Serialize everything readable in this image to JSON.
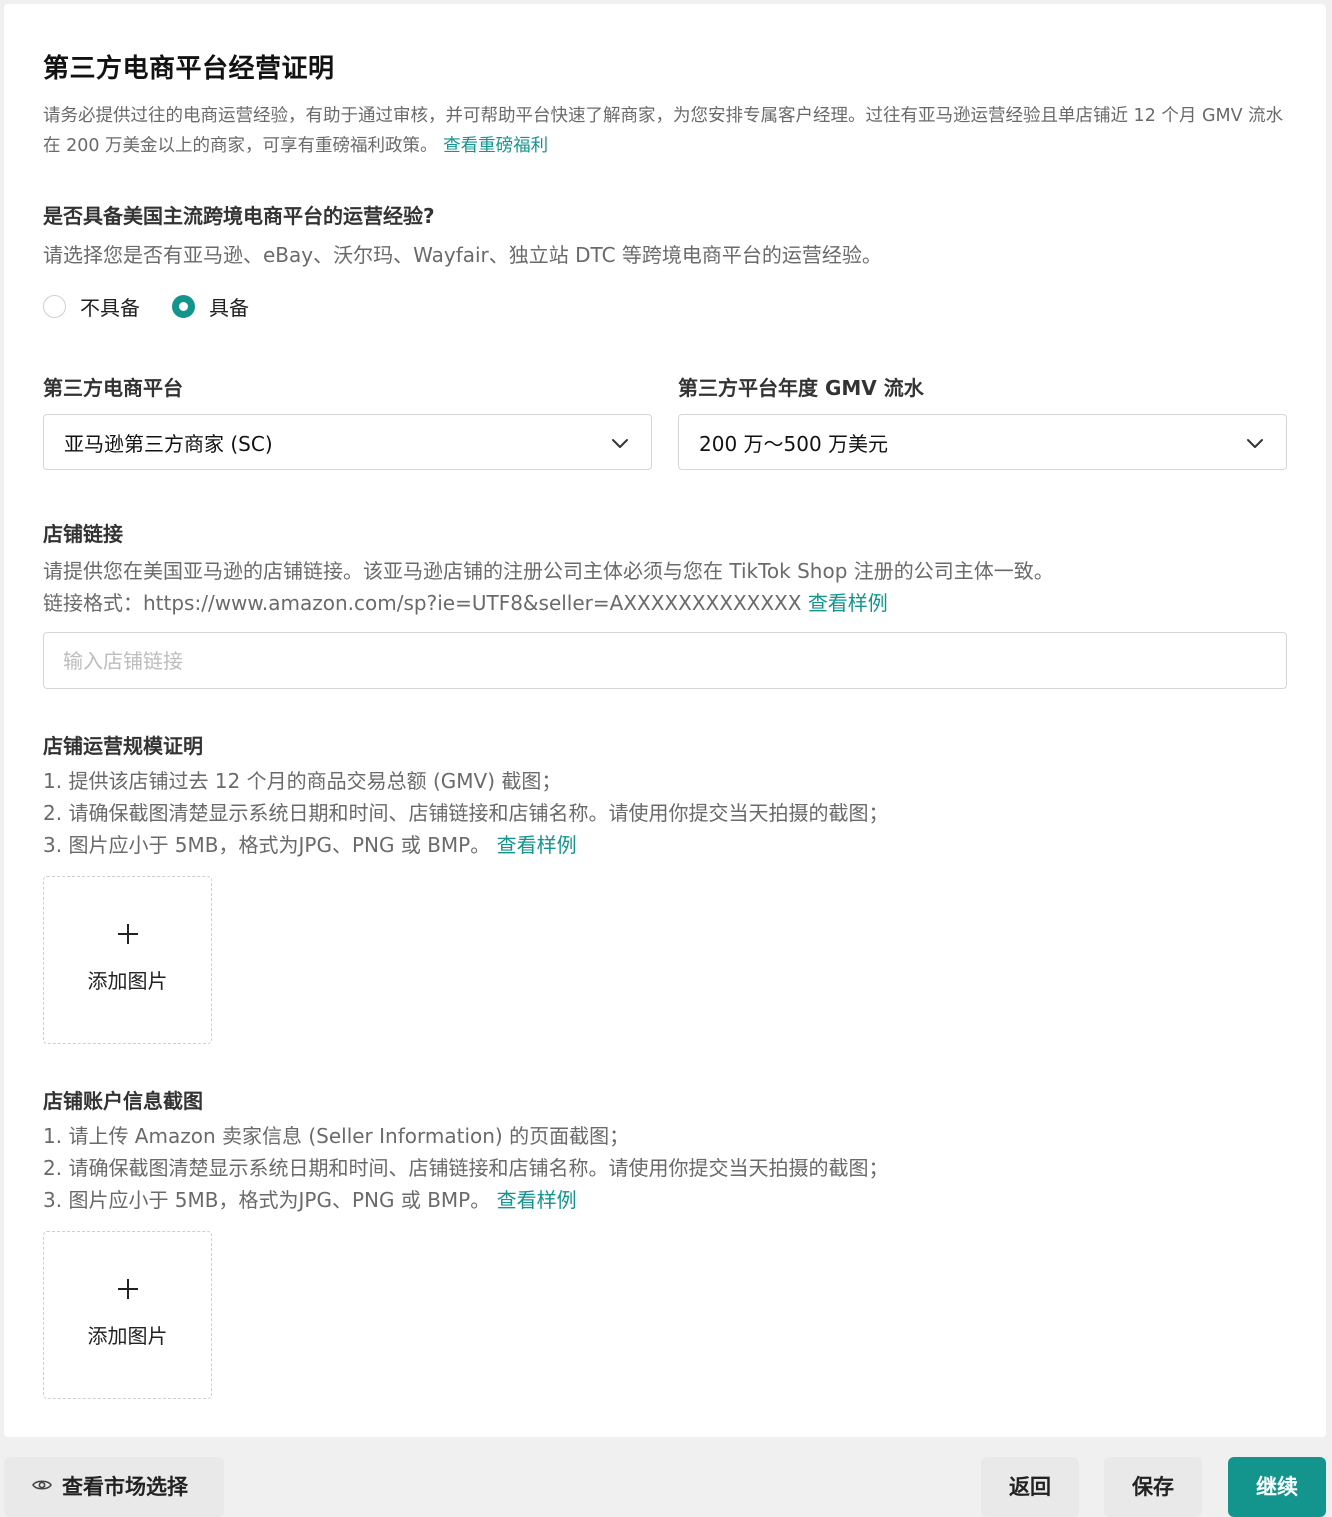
{
  "page_title": "第三方电商平台经营证明",
  "intro": {
    "text": "请务必提供过往的电商运营经验，有助于通过审核，并可帮助平台快速了解商家，为您安排专属客户经理。过往有亚马逊运营经验且单店铺近 12 个月 GMV 流水在 200 万美金以上的商家，可享有重磅福利政策。",
    "link": "查看重磅福利"
  },
  "experience": {
    "title": "是否具备美国主流跨境电商平台的运营经验?",
    "desc": "请选择您是否有亚马逊、eBay、沃尔玛、Wayfair、独立站 DTC 等跨境电商平台的运营经验。",
    "options": [
      {
        "label": "不具备",
        "checked": false
      },
      {
        "label": "具备",
        "checked": true
      }
    ]
  },
  "platform": {
    "label": "第三方电商平台",
    "value": "亚马逊第三方商家 (SC)"
  },
  "gmv": {
    "label": "第三方平台年度 GMV 流水",
    "value": "200 万～500 万美元"
  },
  "store_link": {
    "label": "店铺链接",
    "desc_line1": "请提供您在美国亚马逊的店铺链接。该亚马逊店铺的注册公司主体必须与您在 TikTok Shop 注册的公司主体一致。",
    "desc_line2": "链接格式：https://www.amazon.com/sp?ie=UTF8&seller=AXXXXXXXXXXXXX",
    "link": "查看样例",
    "placeholder": "输入店铺链接",
    "value": ""
  },
  "scale_proof": {
    "label": "店铺运营规模证明",
    "line1": "1. 提供该店铺过去 12 个月的商品交易总额 (GMV) 截图；",
    "line2": "2. 请确保截图清楚显示系统日期和时间、店铺链接和店铺名称。请使用你提交当天拍摄的截图；",
    "line3": "3. 图片应小于 5MB，格式为JPG、PNG 或 BMP。",
    "link": "查看样例",
    "upload_label": "添加图片"
  },
  "account_info": {
    "label": "店铺账户信息截图",
    "line1": "1. 请上传 Amazon 卖家信息 (Seller Information) 的页面截图；",
    "line2": "2. 请确保截图清楚显示系统日期和时间、店铺链接和店铺名称。请使用你提交当天拍摄的截图；",
    "line3": "3. 图片应小于 5MB，格式为JPG、PNG 或 BMP。",
    "link": "查看样例",
    "upload_label": "添加图片"
  },
  "footer": {
    "market_button": "查看市场选择",
    "back_button": "返回",
    "save_button": "保存",
    "continue_button": "继续"
  },
  "colors": {
    "accent": "#13958e",
    "text_primary": "#121212",
    "text_secondary": "#6a6a6a",
    "border": "#d6d6d6"
  }
}
